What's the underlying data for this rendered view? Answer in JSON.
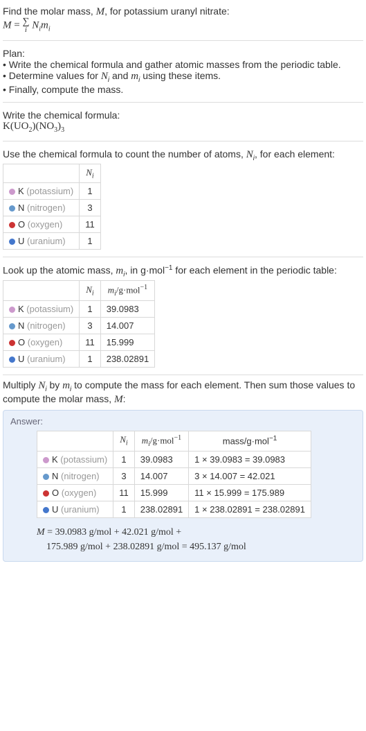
{
  "intro": {
    "line1": "Find the molar mass, ",
    "Mvar": "M",
    "line1b": ", for potassium uranyl nitrate:",
    "eq_lhs": "M",
    "eq_eq": " = ",
    "sigma": "∑",
    "sigma_idx": "i",
    "eq_rhs_a": "N",
    "eq_rhs_a_sub": "i",
    "eq_rhs_b": "m",
    "eq_rhs_b_sub": "i"
  },
  "plan": {
    "heading": "Plan:",
    "b1": "• Write the chemical formula and gather atomic masses from the periodic table.",
    "b2_a": "• Determine values for ",
    "b2_N": "N",
    "b2_Nsub": "i",
    "b2_and": " and ",
    "b2_m": "m",
    "b2_msub": "i",
    "b2_b": " using these items.",
    "b3": "• Finally, compute the mass."
  },
  "writeformula": {
    "heading": "Write the chemical formula:",
    "t1": "K(UO",
    "s1": "2",
    "t2": ")(NO",
    "s2": "3",
    "t3": ")",
    "s3": "3"
  },
  "count": {
    "heading_a": "Use the chemical formula to count the number of atoms, ",
    "heading_N": "N",
    "heading_Nsub": "i",
    "heading_b": ", for each element:",
    "hdr_N": "N",
    "hdr_Nsub": "i"
  },
  "elements": [
    {
      "sym": "K",
      "name": "(potassium)",
      "cls": "k",
      "n": "1",
      "m": "39.0983",
      "mass": "1 × 39.0983 = 39.0983"
    },
    {
      "sym": "N",
      "name": "(nitrogen)",
      "cls": "n",
      "n": "3",
      "m": "14.007",
      "mass": "3 × 14.007 = 42.021"
    },
    {
      "sym": "O",
      "name": "(oxygen)",
      "cls": "o",
      "n": "11",
      "m": "15.999",
      "mass": "11 × 15.999 = 175.989"
    },
    {
      "sym": "U",
      "name": "(uranium)",
      "cls": "u",
      "n": "1",
      "m": "238.02891",
      "mass": "1 × 238.02891 = 238.02891"
    }
  ],
  "lookup": {
    "heading_a": "Look up the atomic mass, ",
    "heading_m": "m",
    "heading_msub": "i",
    "heading_b": ", in g·mol",
    "heading_exp": "−1",
    "heading_c": " for each element in the periodic table:",
    "col_N": "N",
    "col_Nsub": "i",
    "col_m": "m",
    "col_msub": "i",
    "col_unit": "/g·mol",
    "col_unit_exp": "−1"
  },
  "multiply": {
    "heading_a": "Multiply ",
    "heading_N": "N",
    "heading_Nsub": "i",
    "heading_by": " by ",
    "heading_m": "m",
    "heading_msub": "i",
    "heading_b": " to compute the mass for each element. Then sum those values to compute the molar mass, ",
    "heading_M": "M",
    "heading_c": ":"
  },
  "answer": {
    "label": "Answer:",
    "col_N": "N",
    "col_Nsub": "i",
    "col_m": "m",
    "col_msub": "i",
    "col_munit": "/g·mol",
    "col_munit_exp": "−1",
    "col_mass": "mass/g·mol",
    "col_mass_exp": "−1",
    "final_M": "M",
    "final_eq": " = 39.0983 g/mol + 42.021 g/mol + ",
    "final_line2": "175.989 g/mol + 238.02891 g/mol = 495.137 g/mol"
  }
}
